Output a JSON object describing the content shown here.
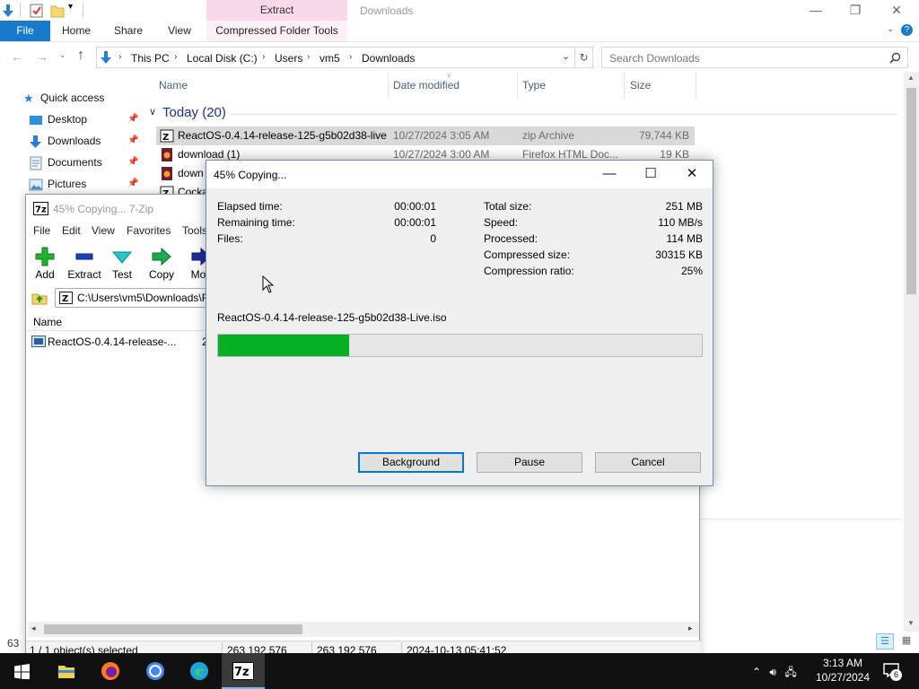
{
  "explorer": {
    "window_title": "Downloads",
    "ribbon": {
      "context_header": "Extract",
      "tabs": [
        "File",
        "Home",
        "Share",
        "View",
        "Compressed Folder Tools"
      ]
    },
    "address": {
      "crumbs": [
        "This PC",
        "Local Disk (C:)",
        "Users",
        "vm5",
        "Downloads"
      ],
      "search_placeholder": "Search Downloads"
    },
    "nav": {
      "quick_access": "Quick access",
      "items": [
        "Desktop",
        "Downloads",
        "Documents",
        "Pictures"
      ]
    },
    "columns": [
      "Name",
      "Date modified",
      "Type",
      "Size"
    ],
    "group": "Today (20)",
    "files": [
      {
        "name": "ReactOS-0.4.14-release-125-g5b02d38-live",
        "date": "10/27/2024 3:05 AM",
        "type": "zip Archive",
        "size": "79,744 KB"
      },
      {
        "name": "download (1)",
        "date": "10/27/2024 3:00 AM",
        "type": "Firefox HTML Doc...",
        "size": "19 KB"
      },
      {
        "name": "down",
        "date": "",
        "type": "",
        "size": ""
      },
      {
        "name": "Cocka",
        "date": "",
        "type": "",
        "size": ""
      }
    ],
    "status_count": "63"
  },
  "sevenzip": {
    "title": "45% Copying... 7-Zip",
    "menu": [
      "File",
      "Edit",
      "View",
      "Favorites",
      "Tools"
    ],
    "toolbar": [
      "Add",
      "Extract",
      "Test",
      "Copy",
      "Mov"
    ],
    "path": "C:\\Users\\vm5\\Downloads\\R",
    "list_header": "Name",
    "row_name": "ReactOS-0.4.14-release-...",
    "row_size_fragment": "2",
    "status": {
      "selected": "1 / 1 object(s) selected",
      "size1": "263 192 576",
      "size2": "263 192 576",
      "modified": "2024-10-13 05:41:52"
    }
  },
  "dialog": {
    "title": "45% Copying...",
    "left": {
      "elapsed_label": "Elapsed time:",
      "elapsed": "00:00:01",
      "remaining_label": "Remaining time:",
      "remaining": "00:00:01",
      "files_label": "Files:",
      "files": "0"
    },
    "right": {
      "total_label": "Total size:",
      "total": "251 MB",
      "speed_label": "Speed:",
      "speed": "110 MB/s",
      "processed_label": "Processed:",
      "processed": "114 MB",
      "compressed_label": "Compressed size:",
      "compressed": "30315 KB",
      "ratio_label": "Compression ratio:",
      "ratio": "25%"
    },
    "current_file": "ReactOS-0.4.14-release-125-g5b02d38-Live.iso",
    "progress_fraction": 0.27,
    "buttons": {
      "background": "Background",
      "pause": "Pause",
      "cancel": "Cancel"
    }
  },
  "taskbar": {
    "time": "3:13 AM",
    "date": "10/27/2024",
    "notifications": "6",
    "apps": [
      "file-explorer",
      "firefox",
      "chrome",
      "edge",
      "7-zip"
    ]
  },
  "colors": {
    "accent": "#1979ca",
    "progress_green": "#06b025",
    "selection": "#d9d9d9",
    "taskbar": "#101010"
  }
}
